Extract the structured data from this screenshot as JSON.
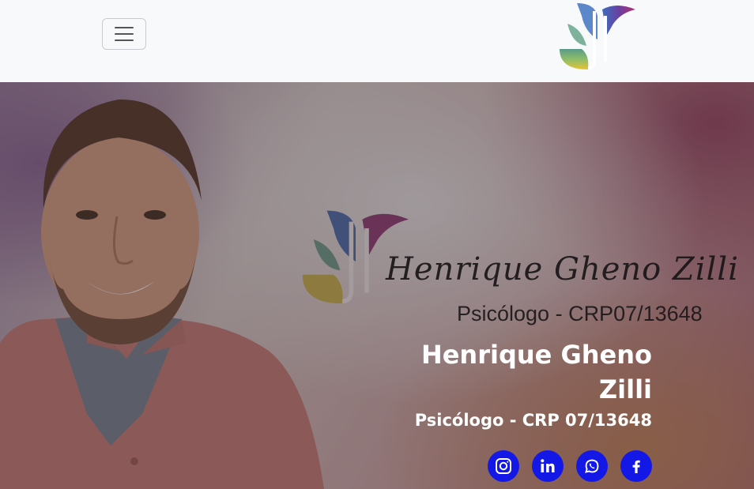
{
  "navbar": {
    "toggler_label": "Toggle navigation",
    "logo_icon": "jf-monogram-logo"
  },
  "hero": {
    "banner": {
      "signature": "Henrique Gheno Zilli",
      "caption": "Psicólogo - CRP07/13648"
    },
    "title": "Henrique Gheno Zilli",
    "subtitle": "Psicólogo - CRP 07/13648",
    "socials": [
      {
        "name": "instagram",
        "icon": "instagram-icon"
      },
      {
        "name": "linkedin",
        "icon": "linkedin-icon"
      },
      {
        "name": "whatsapp",
        "icon": "whatsapp-icon"
      },
      {
        "name": "facebook",
        "icon": "facebook-icon"
      }
    ]
  },
  "colors": {
    "navbar_bg": "#f8f9fa",
    "social_bg": "#1418e6",
    "title_text": "#ffffff"
  }
}
